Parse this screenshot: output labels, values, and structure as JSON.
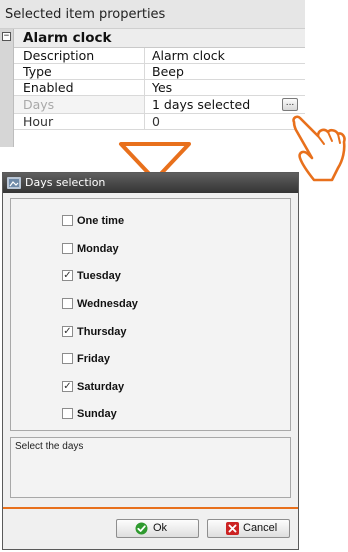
{
  "properties_panel": {
    "header": "Selected item properties",
    "category": "Alarm clock",
    "collapse_glyph": "−",
    "rows": [
      {
        "key": "Description",
        "value": "Alarm clock"
      },
      {
        "key": "Type",
        "value": "Beep"
      },
      {
        "key": "Enabled",
        "value": "Yes"
      },
      {
        "key": "Days",
        "value": "1 days selected"
      },
      {
        "key": "Hour",
        "value": "0"
      }
    ],
    "ellipsis_label": "..."
  },
  "overlay": {
    "arrow_color": "#e8701c",
    "icons": [
      "down-triangle-arrow",
      "pointing-hand-icon"
    ]
  },
  "dialog": {
    "title": "Days selection",
    "options": [
      {
        "label": "One time",
        "checked": false
      },
      {
        "label": "Monday",
        "checked": false
      },
      {
        "label": "Tuesday",
        "checked": true
      },
      {
        "label": "Wednesday",
        "checked": false
      },
      {
        "label": "Thursday",
        "checked": true
      },
      {
        "label": "Friday",
        "checked": false
      },
      {
        "label": "Saturday",
        "checked": true
      },
      {
        "label": "Sunday",
        "checked": false
      }
    ],
    "hint": "Select the days",
    "ok_label": "Ok",
    "cancel_label": "Cancel",
    "accent_color": "#e8701c",
    "ok_icon_color": "#2f9a2f",
    "cancel_icon_color": "#cc2222"
  }
}
